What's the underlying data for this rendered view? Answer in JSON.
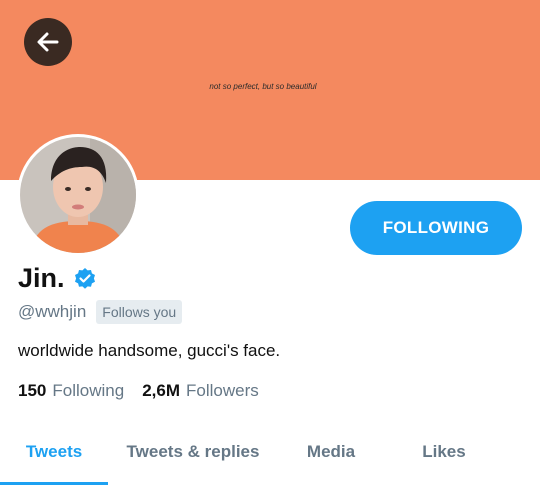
{
  "banner": {
    "caption": "not so perfect, but so beautiful",
    "color": "#f4895f"
  },
  "back_button": {
    "icon": "arrow-left-icon"
  },
  "profile": {
    "display_name": "Jin.",
    "verified": true,
    "handle": "@wwhjin",
    "follows_you": "Follows you",
    "bio": "worldwide handsome, gucci's face.",
    "following_count": "150",
    "following_label": "Following",
    "followers_count": "2,6M",
    "followers_label": "Followers"
  },
  "follow_button": {
    "label": "FOLLOWING",
    "color": "#1da1f2"
  },
  "tabs": [
    {
      "label": "Tweets",
      "active": true
    },
    {
      "label": "Tweets & replies",
      "active": false
    },
    {
      "label": "Media",
      "active": false
    },
    {
      "label": "Likes",
      "active": false
    }
  ]
}
